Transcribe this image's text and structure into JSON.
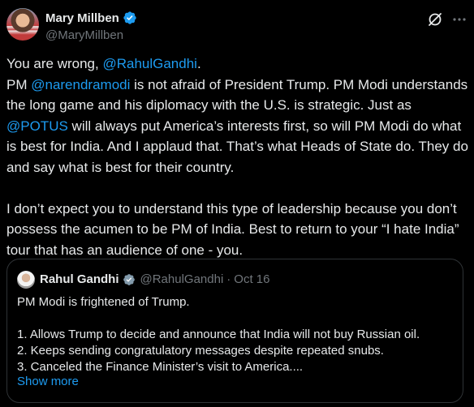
{
  "tweet": {
    "author": {
      "name": "Mary Millben",
      "handle": "@MaryMillben"
    },
    "body": {
      "l1_pre": "You are wrong, ",
      "l1_mention": "@RahulGandhi",
      "l1_post": ".",
      "p2_pre": "PM ",
      "p2_mention1": "@narendramodi",
      "p2_mid": " is not afraid of President Trump. PM Modi understands the long game and his diplomacy with the U.S. is strategic. Just as ",
      "p2_mention2": "@POTUS",
      "p2_post": " will always put America’s interests first, so will PM Modi do what is best for India. And I applaud that. That’s what Heads of State do. They do and say what is best for their country.",
      "p3": "I don’t expect you to understand this type of leadership because you don’t possess the acumen to be PM of India. Best to return to your “I hate India” tour that has an audience of one - you."
    }
  },
  "quote": {
    "author": {
      "name": "Rahul Gandhi",
      "handle": "@RahulGandhi",
      "separator": "·",
      "date": "Oct 16"
    },
    "lines": [
      "PM Modi is frightened of Trump.",
      "1. Allows Trump to decide and announce that India will not buy Russian oil.",
      "2. Keeps sending congratulatory messages despite repeated snubs.",
      "3. Canceled the Finance Minister’s visit to America...."
    ],
    "show_more": "Show more"
  },
  "icons": {
    "verified": "verified-badge-icon",
    "grok": "grok-icon",
    "more": "more-options-icon"
  },
  "colors": {
    "background": "#000000",
    "text": "#e7e9ea",
    "muted": "#71767b",
    "link": "#1d9bf0",
    "border": "#2f3336"
  }
}
